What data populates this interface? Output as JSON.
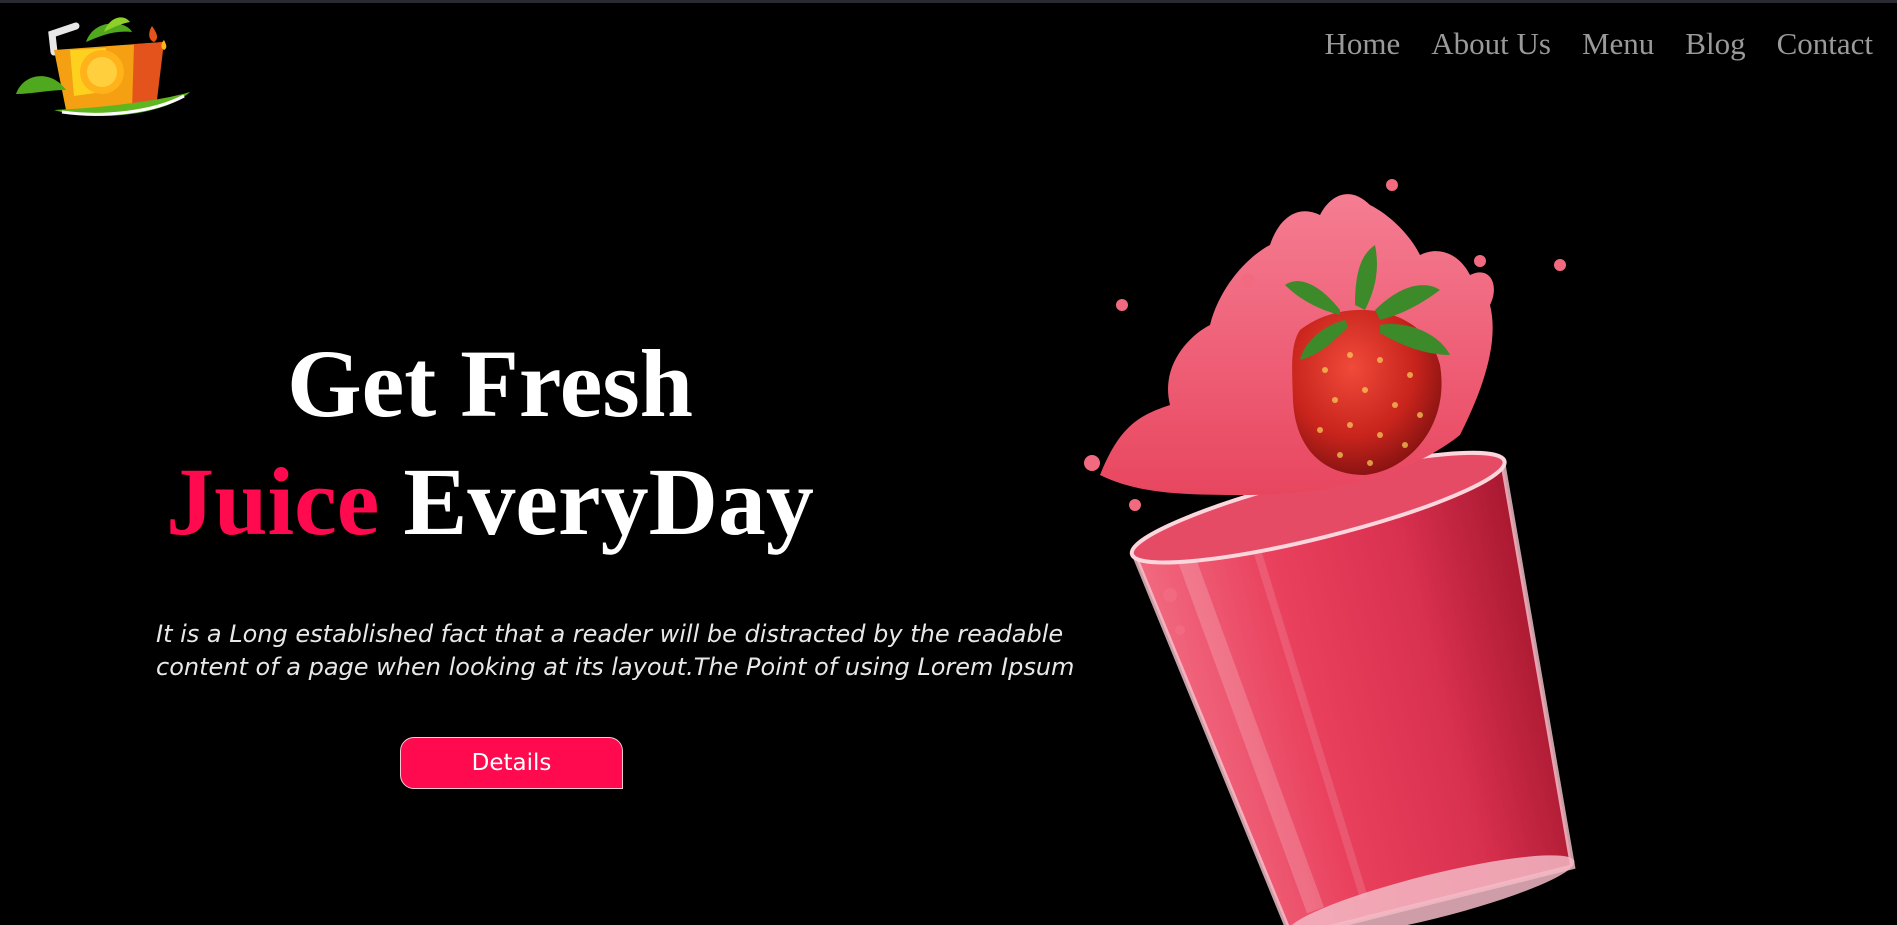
{
  "nav": {
    "items": [
      "Home",
      "About Us",
      "Menu",
      "Blog",
      "Contact"
    ]
  },
  "hero": {
    "title_line1": "Get Fresh",
    "title_accent": "Juice",
    "title_line2_rest": "EveryDay",
    "description": "It is a Long established fact that a reader will be distracted by the readable content of a page when looking at its layout.The Point of using Lorem Ipsum",
    "button_label": "Details"
  },
  "colors": {
    "background": "#000000",
    "accent": "#ff0a4e",
    "nav_text": "#9a9a9a"
  },
  "icons": {
    "logo": "juice-logo",
    "hero_image": "strawberry-juice-glass"
  }
}
